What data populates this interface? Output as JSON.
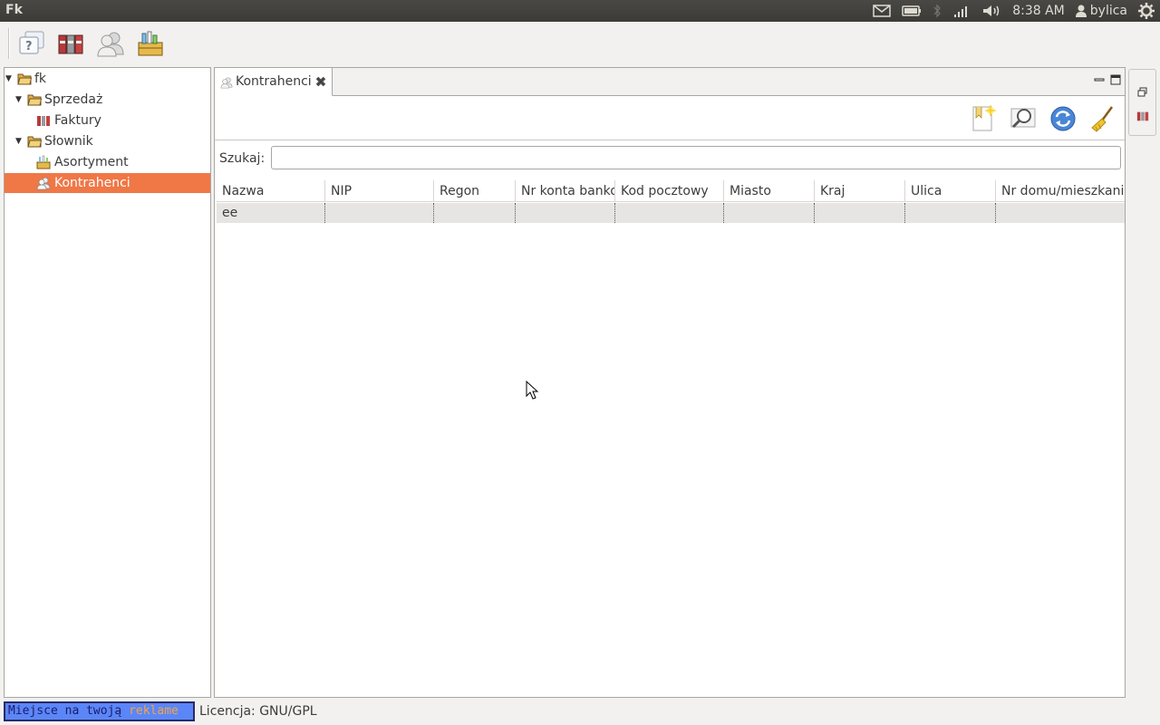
{
  "panel": {
    "app_title": "Fk",
    "clock": "8:38 AM",
    "user": "bylica"
  },
  "toolbar": {
    "buttons": [
      "help-icon",
      "ledger-books-icon",
      "contacts-icon",
      "product-box-icon"
    ]
  },
  "tree": {
    "items": [
      {
        "label": "fk",
        "icon": "folder-icon"
      },
      {
        "label": "Sprzedaż",
        "icon": "folder-icon"
      },
      {
        "label": "Faktury",
        "icon": "ledger-books-icon"
      },
      {
        "label": "Słownik",
        "icon": "folder-icon"
      },
      {
        "label": "Asortyment",
        "icon": "product-box-icon"
      },
      {
        "label": "Kontrahenci",
        "icon": "contacts-icon",
        "selected": true
      }
    ]
  },
  "editor": {
    "tab_label": "Kontrahenci",
    "search_label": "Szukaj:",
    "search_value": "",
    "form_toolbar": [
      "new-record-icon",
      "search-icon",
      "refresh-icon",
      "clear-broom-icon"
    ],
    "columns": [
      "Nazwa",
      "NIP",
      "Regon",
      "Nr konta bankowego",
      "Kod pocztowy",
      "Miasto",
      "Kraj",
      "Ulica",
      "Nr domu/mieszkania"
    ],
    "rows": [
      [
        "ee",
        "",
        "",
        "",
        "",
        "",
        "",
        "",
        ""
      ]
    ]
  },
  "status": {
    "ad_part1": "Miejsce na twoją",
    "ad_part2": "reklame",
    "license": "Licencja: GNU/GPL"
  },
  "colors": {
    "selection": "#f07746",
    "ad_background": "#5b86f7",
    "panel": "#3c3b37"
  }
}
